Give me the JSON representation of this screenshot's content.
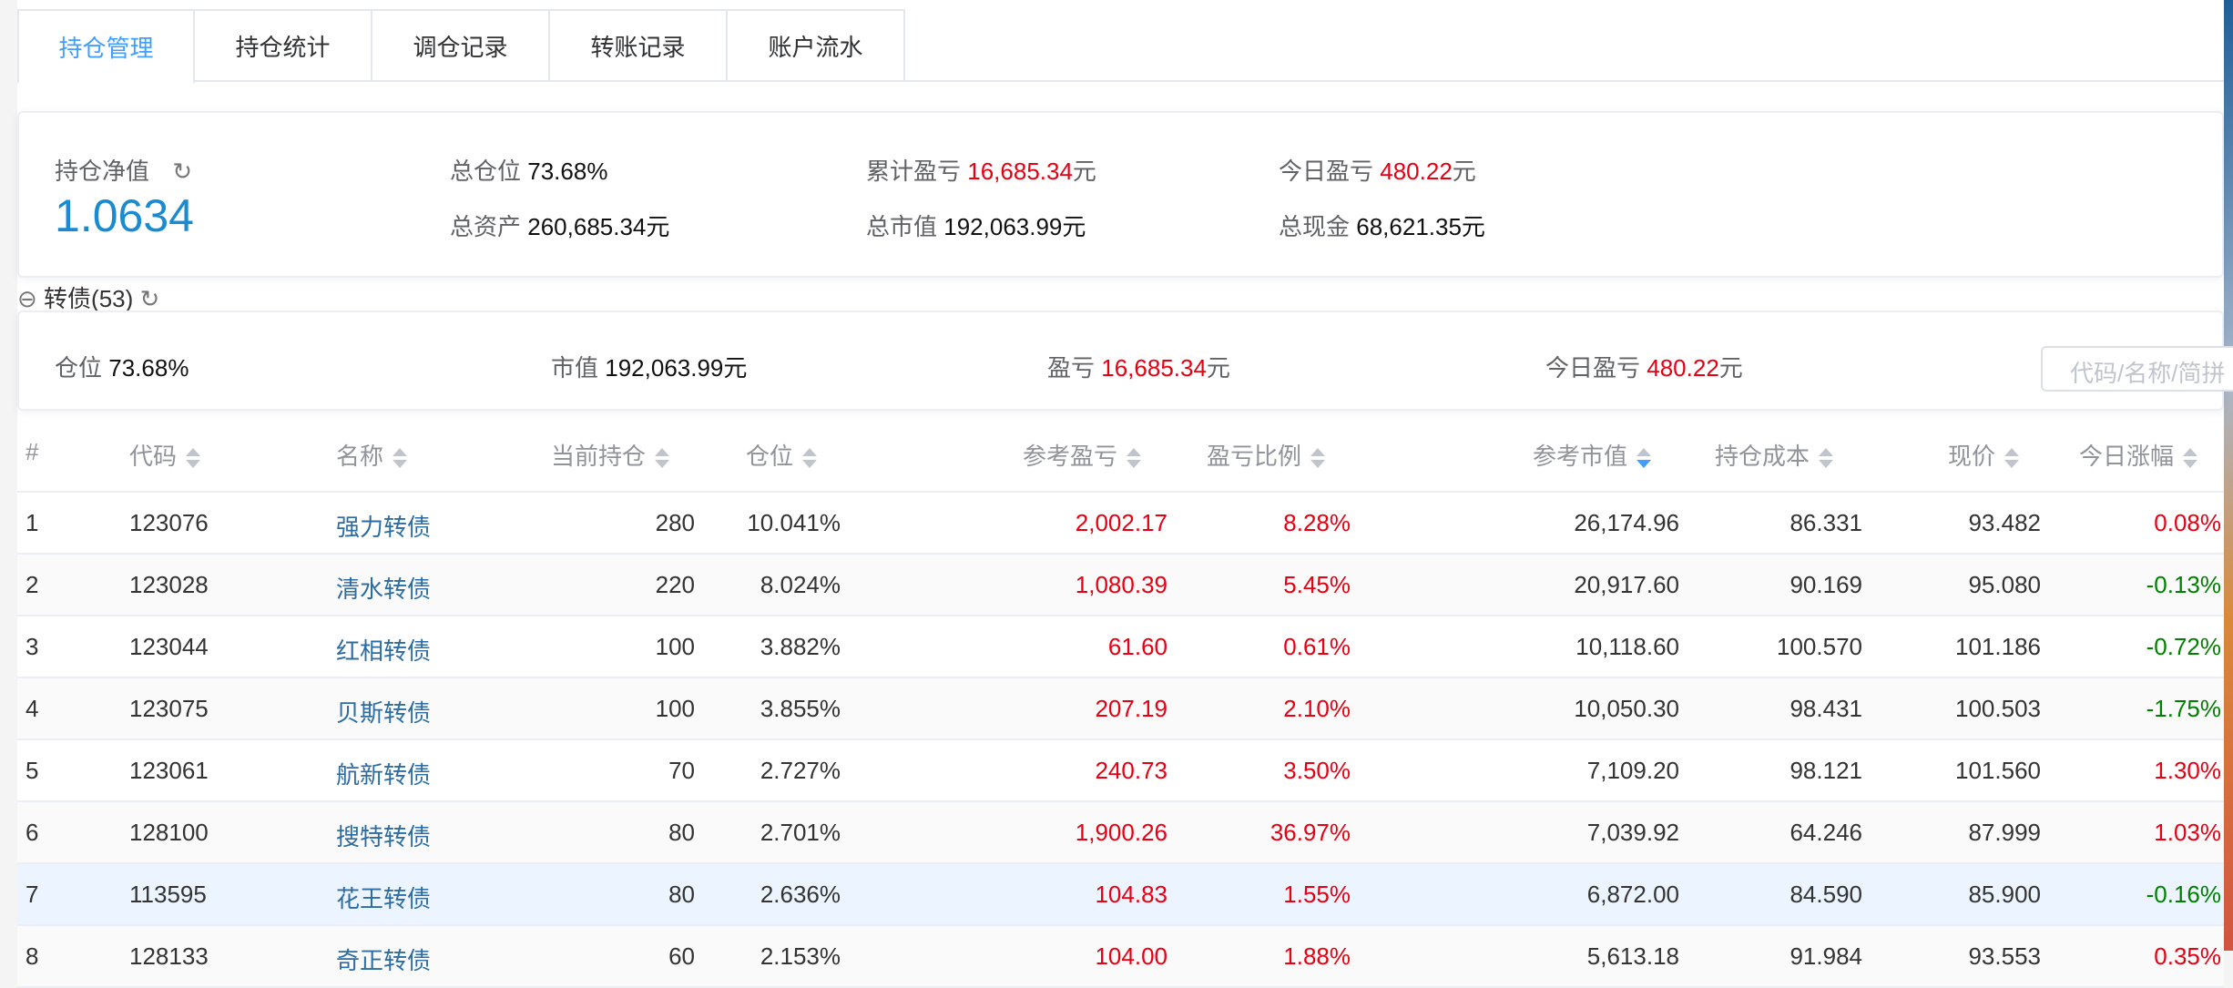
{
  "tabs": [
    "持仓管理",
    "持仓统计",
    "调仓记录",
    "转账记录",
    "账户流水"
  ],
  "summary": {
    "nav_label": "持仓净值",
    "nav_value": "1.0634",
    "position_label": "总仓位",
    "position_value": "73.68%",
    "assets_label": "总资产",
    "assets_value": "260,685.34元",
    "pnl_label": "累计盈亏",
    "pnl_value": "16,685.34",
    "unit": "元",
    "market_label": "总市值",
    "market_value": "192,063.99元",
    "today_label": "今日盈亏",
    "today_value": "480.22",
    "cash_label": "总现金",
    "cash_value": "68,621.35元"
  },
  "group": {
    "title": "转债(53)",
    "position_label": "仓位",
    "position_value": "73.68%",
    "market_label": "市值",
    "market_value": "192,063.99元",
    "pnl_label": "盈亏",
    "pnl_value": "16,685.34",
    "unit": "元",
    "today_label": "今日盈亏",
    "today_value": "480.22",
    "search_placeholder": "代码/名称/简拼"
  },
  "table": {
    "columns": [
      "#",
      "代码",
      "名称",
      "当前持仓",
      "仓位",
      "参考盈亏",
      "盈亏比例",
      "参考市值",
      "持仓成本",
      "现价",
      "今日涨幅"
    ],
    "sorted_column": "参考市值",
    "sort_order": "descending",
    "colors": {
      "up": "#e60012",
      "down": "#008000",
      "link": "#2d6ca2"
    },
    "rows": [
      [
        "1",
        "123076",
        "强力转债",
        "280",
        "10.041%",
        "2,002.17",
        "8.28%",
        "26,174.96",
        "86.331",
        "93.482",
        "0.08%"
      ],
      [
        "2",
        "123028",
        "清水转债",
        "220",
        "8.024%",
        "1,080.39",
        "5.45%",
        "20,917.60",
        "90.169",
        "95.080",
        "-0.13%"
      ],
      [
        "3",
        "123044",
        "红相转债",
        "100",
        "3.882%",
        "61.60",
        "0.61%",
        "10,118.60",
        "100.570",
        "101.186",
        "-0.72%"
      ],
      [
        "4",
        "123075",
        "贝斯转债",
        "100",
        "3.855%",
        "207.19",
        "2.10%",
        "10,050.30",
        "98.431",
        "100.503",
        "-1.75%"
      ],
      [
        "5",
        "123061",
        "航新转债",
        "70",
        "2.727%",
        "240.73",
        "3.50%",
        "7,109.20",
        "98.121",
        "101.560",
        "1.30%"
      ],
      [
        "6",
        "128100",
        "搜特转债",
        "80",
        "2.701%",
        "1,900.26",
        "36.97%",
        "7,039.92",
        "64.246",
        "87.999",
        "1.03%"
      ],
      [
        "7",
        "113595",
        "花王转债",
        "80",
        "2.636%",
        "104.83",
        "1.55%",
        "6,872.00",
        "84.590",
        "85.900",
        "-0.16%"
      ],
      [
        "8",
        "128133",
        "奇正转债",
        "60",
        "2.153%",
        "104.00",
        "1.88%",
        "5,613.18",
        "91.984",
        "93.553",
        "0.35%"
      ]
    ]
  }
}
